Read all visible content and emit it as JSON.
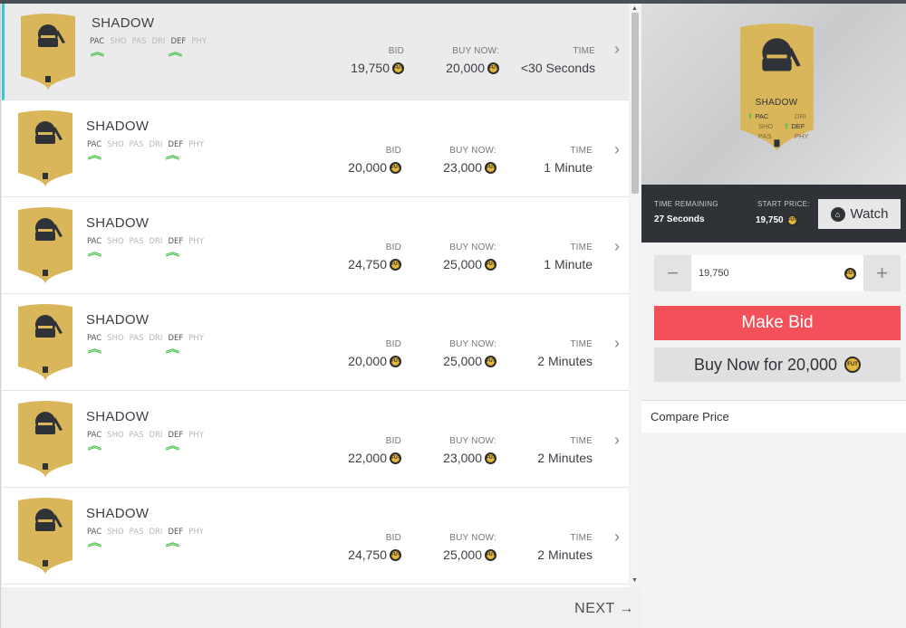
{
  "rows": [
    {
      "name": "SHADOW",
      "bid": "19,750",
      "buy": "20,000",
      "time": "<30 Seconds"
    },
    {
      "name": "SHADOW",
      "bid": "20,000",
      "buy": "23,000",
      "time": "1 Minute"
    },
    {
      "name": "SHADOW",
      "bid": "24,750",
      "buy": "25,000",
      "time": "1 Minute"
    },
    {
      "name": "SHADOW",
      "bid": "20,000",
      "buy": "25,000",
      "time": "2 Minutes"
    },
    {
      "name": "SHADOW",
      "bid": "22,000",
      "buy": "23,000",
      "time": "2 Minutes"
    },
    {
      "name": "SHADOW",
      "bid": "24,750",
      "buy": "25,000",
      "time": "2 Minutes"
    }
  ],
  "labels": {
    "bid": "BID",
    "buy": "BUY NOW:",
    "time": "TIME",
    "next": "NEXT",
    "coin": "FUT"
  },
  "stats": [
    "PAC",
    "SHO",
    "PAS",
    "DRI",
    "DEF",
    "PHY"
  ],
  "detail": {
    "card_name": "SHADOW",
    "card_stats_left": [
      "PAC",
      "SHO",
      "PAS"
    ],
    "card_stats_right": [
      "DRI",
      "DEF",
      "PHY"
    ],
    "time_label": "TIME REMAINING",
    "time_value": "27 Seconds",
    "start_label": "START PRICE:",
    "start_value": "19,750",
    "watch": "Watch",
    "bid_value": "19,750",
    "minus": "−",
    "plus": "+",
    "make_bid": "Make Bid",
    "buy_now": "Buy Now for 20,000",
    "compare": "Compare Price"
  },
  "colors": {
    "accent": "#37c6d6",
    "make_bid": "#f3505a",
    "card_gold": "#d9b65a",
    "info_bar": "#2f3338"
  }
}
